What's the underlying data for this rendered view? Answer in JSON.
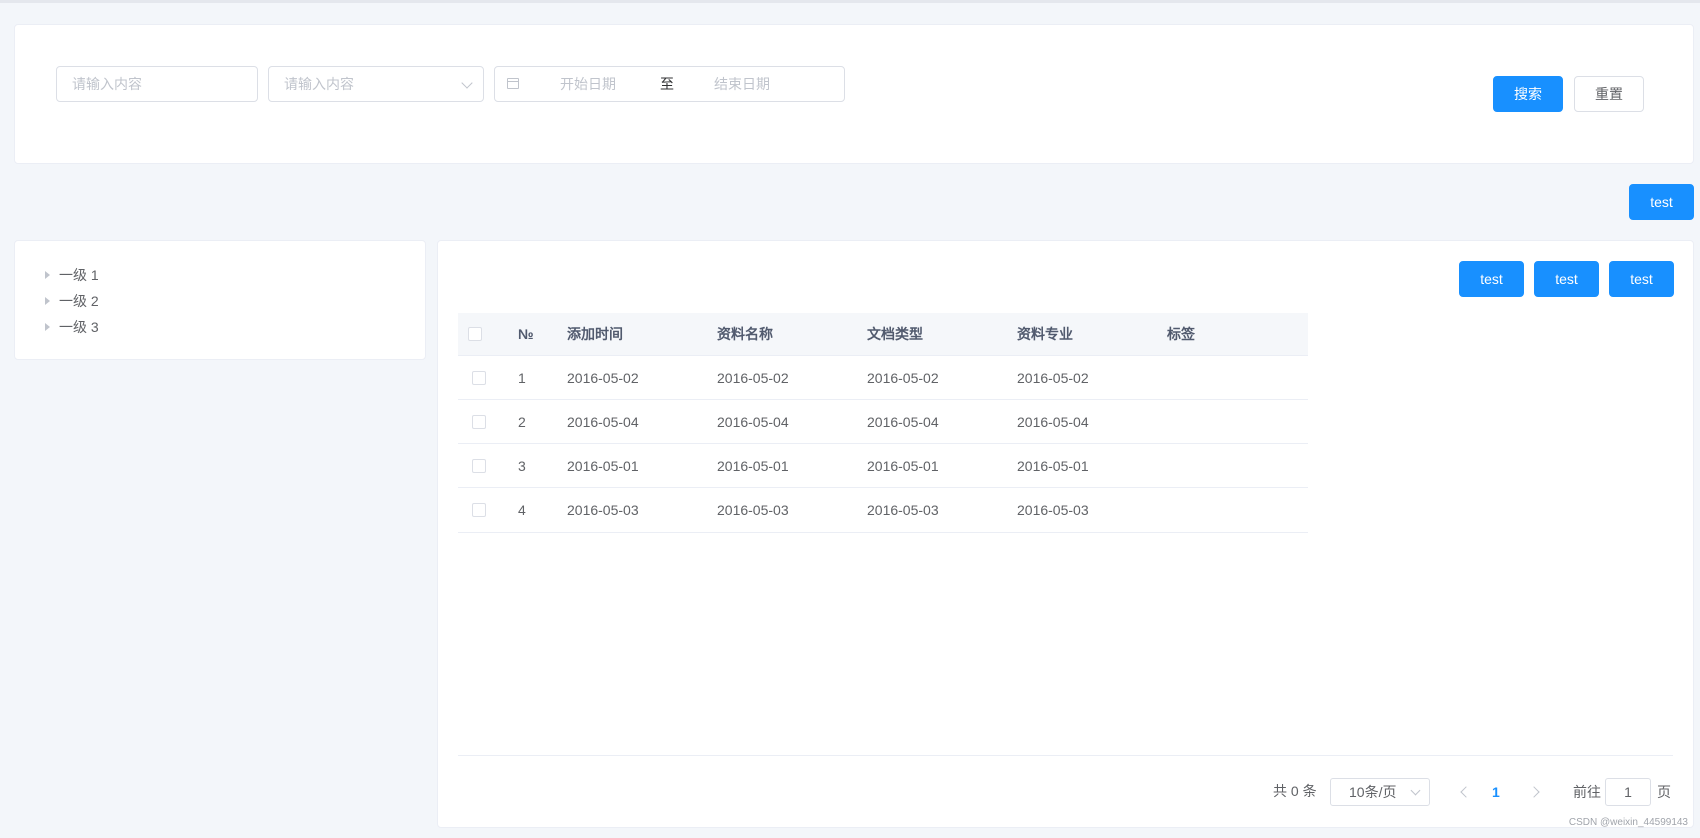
{
  "search": {
    "input_placeholder": "请输入内容",
    "select_placeholder": "请输入内容",
    "date_start_placeholder": "开始日期",
    "date_separator": "至",
    "date_end_placeholder": "结束日期",
    "search_label": "搜索",
    "reset_label": "重置"
  },
  "toolbar": {
    "top_test_label": "test"
  },
  "tree": {
    "nodes": [
      {
        "label": "一级 1"
      },
      {
        "label": "一级 2"
      },
      {
        "label": "一级 3"
      }
    ]
  },
  "table_actions": [
    {
      "label": "test"
    },
    {
      "label": "test"
    },
    {
      "label": "test"
    }
  ],
  "table": {
    "columns": [
      "№",
      "添加时间",
      "资料名称",
      "文档类型",
      "资料专业",
      "标签"
    ],
    "rows": [
      {
        "no": "1",
        "time": "2016-05-02",
        "name": "2016-05-02",
        "type": "2016-05-02",
        "major": "2016-05-02",
        "tag": ""
      },
      {
        "no": "2",
        "time": "2016-05-04",
        "name": "2016-05-04",
        "type": "2016-05-04",
        "major": "2016-05-04",
        "tag": ""
      },
      {
        "no": "3",
        "time": "2016-05-01",
        "name": "2016-05-01",
        "type": "2016-05-01",
        "major": "2016-05-01",
        "tag": ""
      },
      {
        "no": "4",
        "time": "2016-05-03",
        "name": "2016-05-03",
        "type": "2016-05-03",
        "major": "2016-05-03",
        "tag": ""
      }
    ]
  },
  "pagination": {
    "total_text": "共 0 条",
    "page_size": "10条/页",
    "current_page": "1",
    "goto_label": "前往",
    "goto_value": "1",
    "page_suffix": "页"
  },
  "watermark": "CSDN @weixin_44599143",
  "colors": {
    "primary": "#1890ff",
    "background": "#f3f6fa",
    "border": "#dcdfe6"
  }
}
